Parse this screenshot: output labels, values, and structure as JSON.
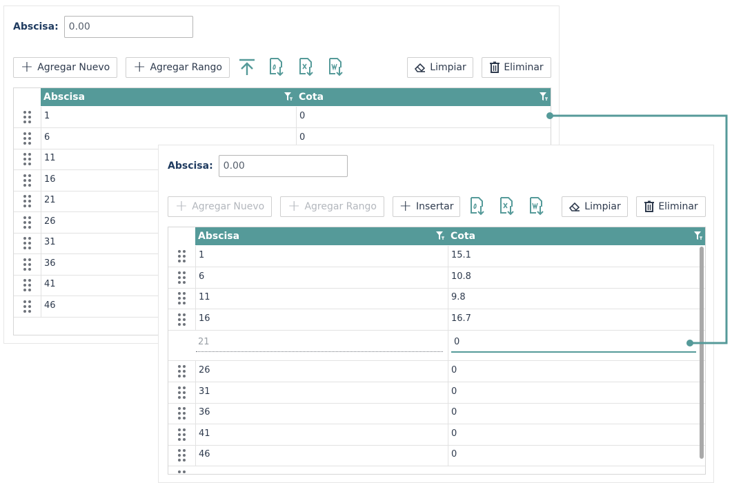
{
  "back": {
    "abscisa_label": "Abscisa:",
    "abscisa_value": "0.00",
    "buttons": {
      "add_new": "Agregar Nuevo",
      "add_range": "Agregar Rango",
      "clear": "Limpiar",
      "delete": "Eliminar"
    },
    "columns": {
      "abscisa": "Abscisa",
      "cota": "Cota"
    },
    "rows": [
      {
        "abscisa": "1",
        "cota": "0"
      },
      {
        "abscisa": "6",
        "cota": "0"
      },
      {
        "abscisa": "11",
        "cota": ""
      },
      {
        "abscisa": "16",
        "cota": ""
      },
      {
        "abscisa": "21",
        "cota": ""
      },
      {
        "abscisa": "26",
        "cota": ""
      },
      {
        "abscisa": "31",
        "cota": ""
      },
      {
        "abscisa": "36",
        "cota": ""
      },
      {
        "abscisa": "41",
        "cota": ""
      },
      {
        "abscisa": "46",
        "cota": ""
      }
    ]
  },
  "front": {
    "abscisa_label": "Abscisa:",
    "abscisa_value": "0.00",
    "buttons": {
      "add_new": "Agregar Nuevo",
      "add_range": "Agregar Rango",
      "insert": "Insertar",
      "clear": "Limpiar",
      "delete": "Eliminar"
    },
    "columns": {
      "abscisa": "Abscisa",
      "cota": "Cota"
    },
    "rows": [
      {
        "abscisa": "1",
        "cota": "15.1"
      },
      {
        "abscisa": "6",
        "cota": "10.8"
      },
      {
        "abscisa": "11",
        "cota": "9.8"
      },
      {
        "abscisa": "16",
        "cota": "16.7"
      }
    ],
    "editing_row": {
      "abscisa": "21",
      "cota": "0"
    },
    "rows_after": [
      {
        "abscisa": "26",
        "cota": "0"
      },
      {
        "abscisa": "31",
        "cota": "0"
      },
      {
        "abscisa": "36",
        "cota": "0"
      },
      {
        "abscisa": "41",
        "cota": "0"
      },
      {
        "abscisa": "46",
        "cota": "0"
      }
    ]
  },
  "colors": {
    "header": "#559a99",
    "text": "#2e3a4d",
    "label": "#1e3a5f",
    "connector": "#559a99"
  },
  "icons": {
    "toolbar_back": [
      "upload-icon",
      "pdf-export-icon",
      "excel-export-icon",
      "word-export-icon"
    ],
    "toolbar_front": [
      "pdf-export-icon",
      "excel-export-icon",
      "word-export-icon"
    ],
    "clear": "eraser-icon",
    "delete": "trash-icon",
    "filter": "filter-icon",
    "drag": "drag-handle-icon"
  }
}
